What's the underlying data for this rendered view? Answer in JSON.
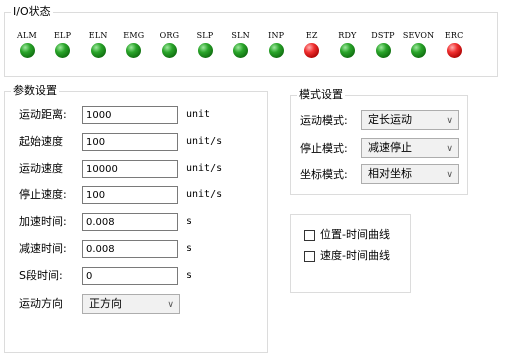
{
  "io_status": {
    "title": "I/O状态",
    "leds": [
      {
        "label": "ALM",
        "color": "green"
      },
      {
        "label": "ELP",
        "color": "green"
      },
      {
        "label": "ELN",
        "color": "green"
      },
      {
        "label": "EMG",
        "color": "green"
      },
      {
        "label": "ORG",
        "color": "green"
      },
      {
        "label": "SLP",
        "color": "green"
      },
      {
        "label": "SLN",
        "color": "green"
      },
      {
        "label": "INP",
        "color": "green"
      },
      {
        "label": "EZ",
        "color": "red"
      },
      {
        "label": "RDY",
        "color": "green"
      },
      {
        "label": "DSTP",
        "color": "green"
      },
      {
        "label": "SEVON",
        "color": "green"
      },
      {
        "label": "ERC",
        "color": "red"
      }
    ]
  },
  "params": {
    "title": "参数设置",
    "rows": [
      {
        "label": "运动距离:",
        "value": "1000",
        "unit": "unit"
      },
      {
        "label": "起始速度",
        "value": "100",
        "unit": "unit/s"
      },
      {
        "label": "运动速度",
        "value": "10000",
        "unit": "unit/s"
      },
      {
        "label": "停止速度:",
        "value": "100",
        "unit": "unit/s"
      },
      {
        "label": "加速时间:",
        "value": "0.008",
        "unit": "s"
      },
      {
        "label": "减速时间:",
        "value": "0.008",
        "unit": "s"
      },
      {
        "label": "S段时间:",
        "value": "0",
        "unit": "s"
      }
    ],
    "direction_label": "运动方向",
    "direction_value": "正方向"
  },
  "mode": {
    "title": "模式设置",
    "motion_mode_label": "运动模式:",
    "motion_mode_value": "定长运动",
    "stop_mode_label": "停止模式:",
    "stop_mode_value": "减速停止",
    "coord_mode_label": "坐标模式:",
    "coord_mode_value": "相对坐标"
  },
  "curves": {
    "position_time_label": "位置-时间曲线",
    "velocity_time_label": "速度-时间曲线"
  },
  "colors": {
    "led_on": "#2aa52a",
    "led_alarm": "#f03030"
  }
}
